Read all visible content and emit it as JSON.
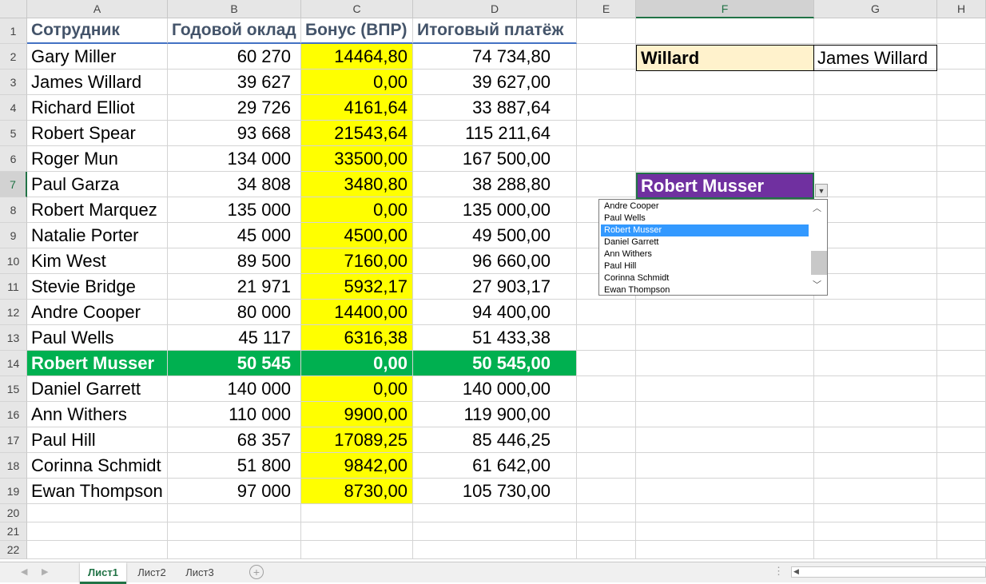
{
  "columns": [
    "A",
    "B",
    "C",
    "D",
    "E",
    "F",
    "G",
    "H"
  ],
  "rows": [
    "1",
    "2",
    "3",
    "4",
    "5",
    "6",
    "7",
    "8",
    "9",
    "10",
    "11",
    "12",
    "13",
    "14",
    "15",
    "16",
    "17",
    "18",
    "19",
    "20",
    "21",
    "22"
  ],
  "table": {
    "headers": [
      "Сотрудник",
      "Годовой оклад",
      "Бонус (ВПР)",
      "Итоговый платёж"
    ],
    "data": [
      [
        "Gary Miller",
        "60 270",
        "14464,80",
        "74 734,80"
      ],
      [
        "James Willard",
        "39 627",
        "0,00",
        "39 627,00"
      ],
      [
        "Richard Elliot",
        "29 726",
        "4161,64",
        "33 887,64"
      ],
      [
        "Robert Spear",
        "93 668",
        "21543,64",
        "115 211,64"
      ],
      [
        "Roger Mun",
        "134 000",
        "33500,00",
        "167 500,00"
      ],
      [
        "Paul Garza",
        "34 808",
        "3480,80",
        "38 288,80"
      ],
      [
        "Robert Marquez",
        "135 000",
        "0,00",
        "135 000,00"
      ],
      [
        "Natalie Porter",
        "45 000",
        "4500,00",
        "49 500,00"
      ],
      [
        "Kim West",
        "89 500",
        "7160,00",
        "96 660,00"
      ],
      [
        "Stevie Bridge",
        "21 971",
        "5932,17",
        "27 903,17"
      ],
      [
        "Andre Cooper",
        "80 000",
        "14400,00",
        "94 400,00"
      ],
      [
        "Paul Wells",
        "45 117",
        "6316,38",
        "51 433,38"
      ],
      [
        "Robert Musser",
        "50 545",
        "0,00",
        "50 545,00"
      ],
      [
        "Daniel Garrett",
        "140 000",
        "0,00",
        "140 000,00"
      ],
      [
        "Ann Withers",
        "110 000",
        "9900,00",
        "119 900,00"
      ],
      [
        "Paul Hill",
        "68 357",
        "17089,25",
        "85 446,25"
      ],
      [
        "Corinna Schmidt",
        "51 800",
        "9842,00",
        "61 642,00"
      ],
      [
        "Ewan Thompson",
        "97 000",
        "8730,00",
        "105 730,00"
      ]
    ],
    "highlight_row_index": 12
  },
  "lookup": {
    "key": "Willard",
    "result": "James Willard"
  },
  "selected_cell": {
    "value": "Robert Musser"
  },
  "dropdown": {
    "items": [
      "Andre Cooper",
      "Paul Wells",
      "Robert Musser",
      "Daniel Garrett",
      "Ann Withers",
      "Paul Hill",
      "Corinna Schmidt",
      "Ewan Thompson"
    ],
    "selected_index": 2
  },
  "sheets": [
    {
      "label": "Лист1",
      "active": true
    },
    {
      "label": "Лист2",
      "active": false
    },
    {
      "label": "Лист3",
      "active": false
    }
  ],
  "colors": {
    "yellow": "#ffff00",
    "green": "#00b050",
    "purple": "#7030a0",
    "lookup_fill": "#fff2cc",
    "accent": "#217346"
  }
}
